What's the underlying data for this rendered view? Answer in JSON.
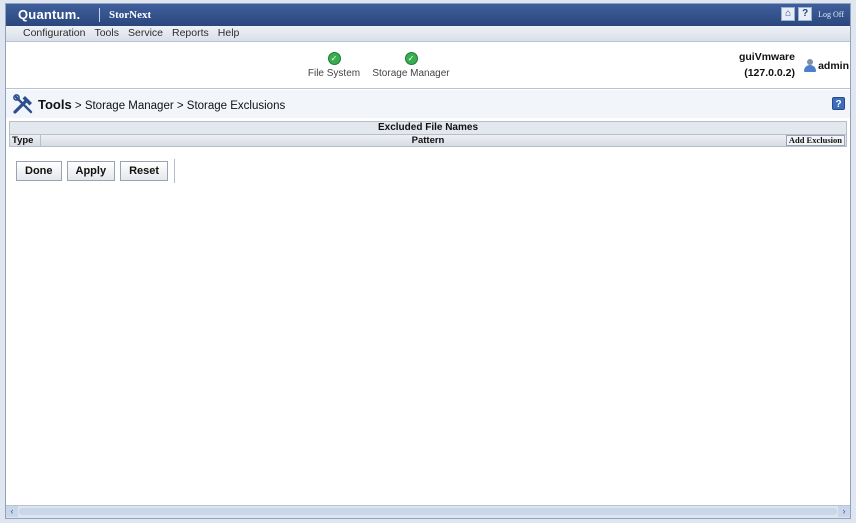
{
  "header": {
    "brand": "Quantum.",
    "product": "StorNext",
    "logoff": "Log Off",
    "home_icon": "home-icon",
    "help_icon": "help-icon"
  },
  "menu": [
    "Configuration",
    "Tools",
    "Service",
    "Reports",
    "Help"
  ],
  "status": [
    {
      "label": "File System",
      "state": "ok",
      "color": "#39ad4f"
    },
    {
      "label": "Storage Manager",
      "state": "ok",
      "color": "#39ad4f"
    }
  ],
  "server": {
    "hostname": "guiVmware",
    "address": "(127.0.0.2)"
  },
  "user": {
    "name": "admin"
  },
  "page": {
    "section": "Tools",
    "crumbs": "> Storage Manager > Storage Exclusions"
  },
  "table": {
    "caption": "Excluded File Names",
    "columns": [
      "Type",
      "Pattern"
    ],
    "add_button": "Add Exclusion",
    "rows": []
  },
  "buttons": {
    "done": "Done",
    "apply": "Apply",
    "reset": "Reset"
  },
  "colors": {
    "header": "#2b467d",
    "ok": "#39ad4f",
    "help": "#3e6dbf"
  }
}
